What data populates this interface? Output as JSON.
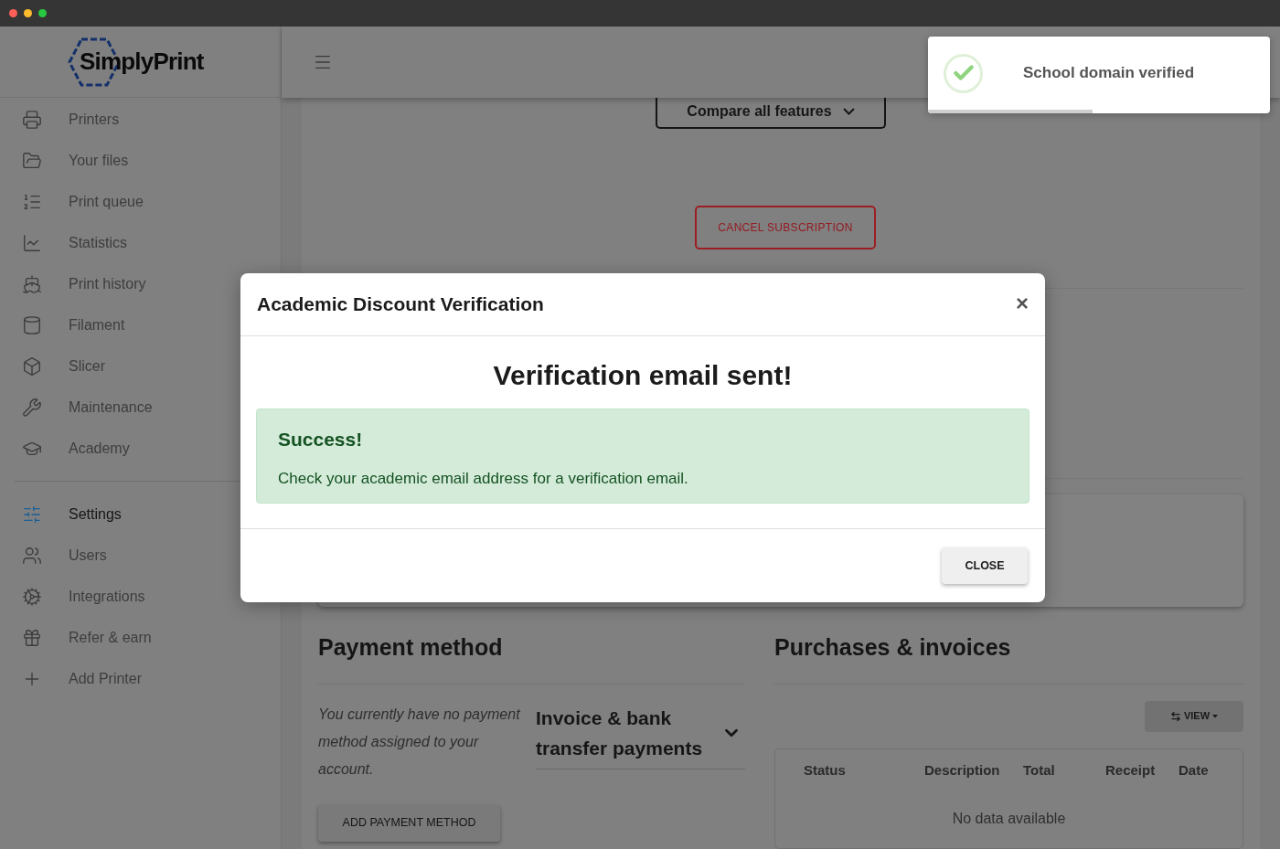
{
  "window": {
    "controls": [
      {
        "color": "#fe5f57"
      },
      {
        "color": "#febc2e"
      },
      {
        "color": "#28c840"
      }
    ]
  },
  "brand": {
    "name": "SimplyPrint"
  },
  "sidebar": {
    "items": [
      {
        "label": "Printers",
        "selected": false
      },
      {
        "label": "Your files",
        "selected": false
      },
      {
        "label": "Print queue",
        "selected": false
      },
      {
        "label": "Statistics",
        "selected": false
      },
      {
        "label": "Print history",
        "selected": false
      },
      {
        "label": "Filament",
        "selected": false
      },
      {
        "label": "Slicer",
        "selected": false
      },
      {
        "label": "Maintenance",
        "selected": false
      },
      {
        "label": "Academy",
        "selected": false
      }
    ],
    "secondary_items": [
      {
        "label": "Settings",
        "selected": true
      },
      {
        "label": "Users",
        "selected": false
      },
      {
        "label": "Integrations",
        "selected": false
      },
      {
        "label": "Refer & earn",
        "selected": false
      },
      {
        "label": "Add Printer",
        "selected": false
      }
    ]
  },
  "plan": {
    "compare_button": "Compare all features",
    "cancel_button": "CANCEL SUBSCRIPTION"
  },
  "payment": {
    "title": "Payment method",
    "note": "You currently have no payment method assigned to your account.",
    "accordion": {
      "title": "Invoice & bank transfer payments",
      "expanded": false
    },
    "add_button": "ADD PAYMENT METHOD"
  },
  "invoices": {
    "title": "Purchases & invoices",
    "view_button": "VIEW",
    "columns": [
      "Status",
      "Description",
      "Total",
      "Receipt",
      "Date"
    ],
    "empty": "No data available"
  },
  "modal": {
    "title": "Academic Discount Verification",
    "close_icon": "×",
    "heading": "Verification email sent!",
    "alert": {
      "title": "Success!",
      "message": "Check your academic email address for a verification email."
    },
    "close_button": "CLOSE"
  },
  "toast": {
    "message": "School domain verified",
    "level": 0.48
  }
}
